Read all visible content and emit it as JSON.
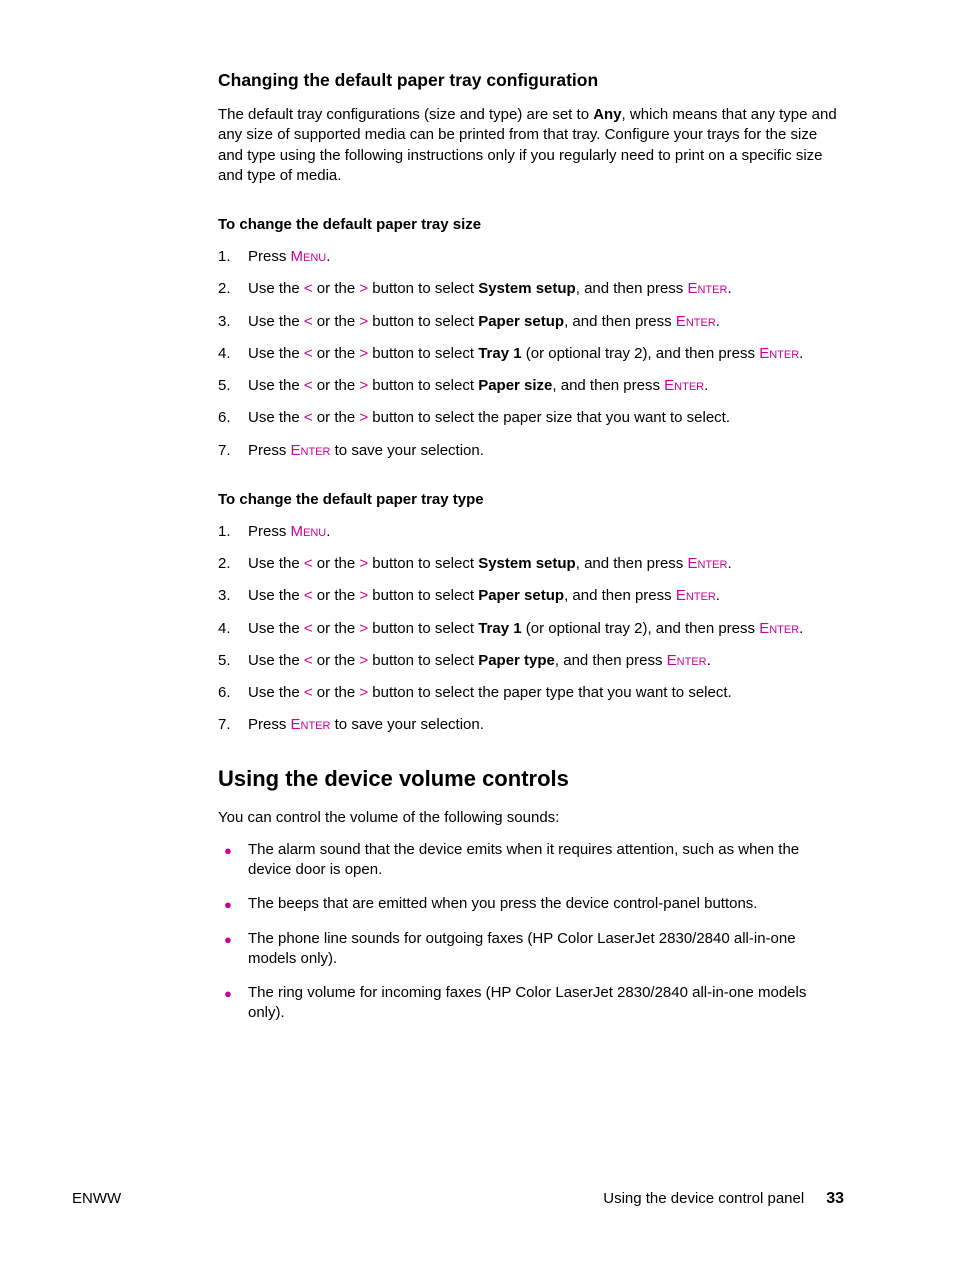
{
  "section1": {
    "heading": "Changing the default paper tray configuration",
    "intro_pre": "The default tray configurations (size and type) are set to ",
    "intro_bold": "Any",
    "intro_post": ", which means that any type and any size of supported media can be printed from that tray. Configure your trays for the size and type using the following instructions only if you regularly need to print on a specific size and type of media."
  },
  "sizeproc": {
    "heading": "To change the default paper tray size",
    "steps": [
      {
        "n": "1.",
        "pre": "Press ",
        "sc": "Menu",
        "post": "."
      },
      {
        "n": "2.",
        "pre": "Use the ",
        "lt": "<",
        "mid1": " or the ",
        "gt": ">",
        "mid2": " button to select ",
        "bold": "System setup",
        "post2": ", and then press ",
        "sc": "Enter",
        "end": "."
      },
      {
        "n": "3.",
        "pre": "Use the ",
        "lt": "<",
        "mid1": " or the ",
        "gt": ">",
        "mid2": " button to select ",
        "bold": "Paper setup",
        "post2": ", and then press ",
        "sc": "Enter",
        "end": "."
      },
      {
        "n": "4.",
        "pre": "Use the ",
        "lt": "<",
        "mid1": " or the ",
        "gt": ">",
        "mid2": " button to select ",
        "bold": "Tray 1",
        "post2": " (or optional tray 2), and then press ",
        "sc": "Enter",
        "end": "."
      },
      {
        "n": "5.",
        "pre": "Use the ",
        "lt": "<",
        "mid1": " or the ",
        "gt": ">",
        "mid2": " button to select ",
        "bold": "Paper size",
        "post2": ", and then press ",
        "sc": "Enter",
        "end": "."
      },
      {
        "n": "6.",
        "pre": "Use the ",
        "lt": "<",
        "mid1": " or the ",
        "gt": ">",
        "mid2": " button to select the paper size that you want to select.",
        "plain": true
      },
      {
        "n": "7.",
        "pre": "Press ",
        "sc": "Enter",
        "post": " to save your selection."
      }
    ]
  },
  "typeproc": {
    "heading": "To change the default paper tray type",
    "steps": [
      {
        "n": "1.",
        "pre": "Press ",
        "sc": "Menu",
        "post": "."
      },
      {
        "n": "2.",
        "pre": "Use the ",
        "lt": "<",
        "mid1": " or the ",
        "gt": ">",
        "mid2": " button to select ",
        "bold": "System setup",
        "post2": ", and then press ",
        "sc": "Enter",
        "end": "."
      },
      {
        "n": "3.",
        "pre": "Use the ",
        "lt": "<",
        "mid1": " or the ",
        "gt": ">",
        "mid2": " button to select ",
        "bold": "Paper setup",
        "post2": ", and then press ",
        "sc": "Enter",
        "end": "."
      },
      {
        "n": "4.",
        "pre": "Use the ",
        "lt": "<",
        "mid1": " or the ",
        "gt": ">",
        "mid2": " button to select ",
        "bold": "Tray 1",
        "post2": " (or optional tray 2), and then press ",
        "sc": "Enter",
        "end": "."
      },
      {
        "n": "5.",
        "pre": "Use the ",
        "lt": "<",
        "mid1": " or the ",
        "gt": ">",
        "mid2": " button to select ",
        "bold": "Paper type",
        "post2": ", and then press ",
        "sc": "Enter",
        "end": "."
      },
      {
        "n": "6.",
        "pre": "Use the ",
        "lt": "<",
        "mid1": " or the ",
        "gt": ">",
        "mid2": " button to select the paper type that you want to select.",
        "plain": true
      },
      {
        "n": "7.",
        "pre": "Press ",
        "sc": "Enter",
        "post": " to save your selection."
      }
    ]
  },
  "section2": {
    "heading": "Using the device volume controls",
    "intro": "You can control the volume of the following sounds:",
    "bullets": [
      "The alarm sound that the device emits when it requires attention, such as when the device door is open.",
      "The beeps that are emitted when you press the device control-panel buttons.",
      "The phone line sounds for outgoing faxes (HP Color LaserJet 2830/2840 all-in-one models only).",
      "The ring volume for incoming faxes (HP Color LaserJet 2830/2840 all-in-one models only)."
    ]
  },
  "footer": {
    "left": "ENWW",
    "right": "Using the device control panel",
    "pagenum": "33"
  }
}
